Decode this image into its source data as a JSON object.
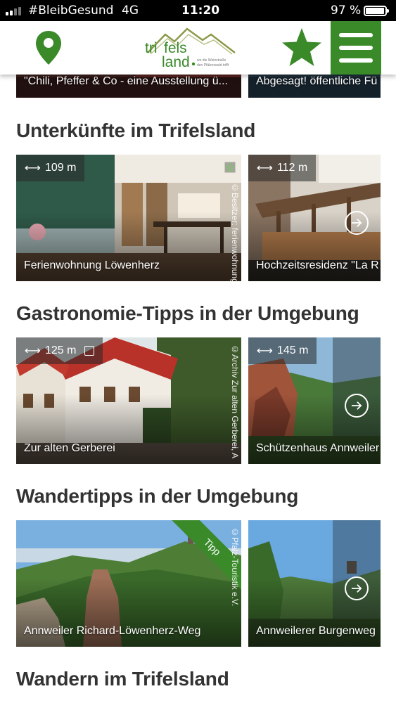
{
  "status_bar": {
    "carrier": "#BleibGesund",
    "network": "4G",
    "time": "11:20",
    "battery": "97 %"
  },
  "header": {
    "logo_text": "trifels land",
    "logo_tagline": "wo die Weinstraße den Pfälzerwald trifft",
    "icons": [
      "location-pin-icon",
      "favorite-star-icon",
      "hamburger-menu-icon"
    ],
    "accent_color": "#3a8a2a"
  },
  "top_row": {
    "cards": [
      {
        "label": "\"Chili, Pfeffer & Co - eine Ausstellung ü..."
      },
      {
        "label": "Abgesagt! öffentliche Fü"
      }
    ]
  },
  "sections": [
    {
      "title": "Unterkünfte im Trifelsland",
      "cards": [
        {
          "label": "Ferienwohnung Löwenherz",
          "distance": "109 m",
          "copyright": "©Besitzer: ferienwohnung.d"
        },
        {
          "label": "Hochzeitsresidenz \"La R",
          "distance": "112 m"
        }
      ]
    },
    {
      "title": "Gastronomie-Tipps in der Umgebung",
      "cards": [
        {
          "label": "Zur alten Gerberei",
          "distance": "125 m",
          "copyright": "©Archiv Zur alten Gerberei, A"
        },
        {
          "label": "Schützenhaus Annweiler",
          "distance": "145 m"
        }
      ]
    },
    {
      "title": "Wandertipps in der Umgebung",
      "cards": [
        {
          "label": "Annweiler Richard-Löwenherz-Weg",
          "copyright": "©Pfalz-Touristik e.V.",
          "badge": "Tipp"
        },
        {
          "label": "Annweilerer Burgenweg"
        }
      ]
    },
    {
      "title": "Wandern im Trifelsland"
    }
  ]
}
